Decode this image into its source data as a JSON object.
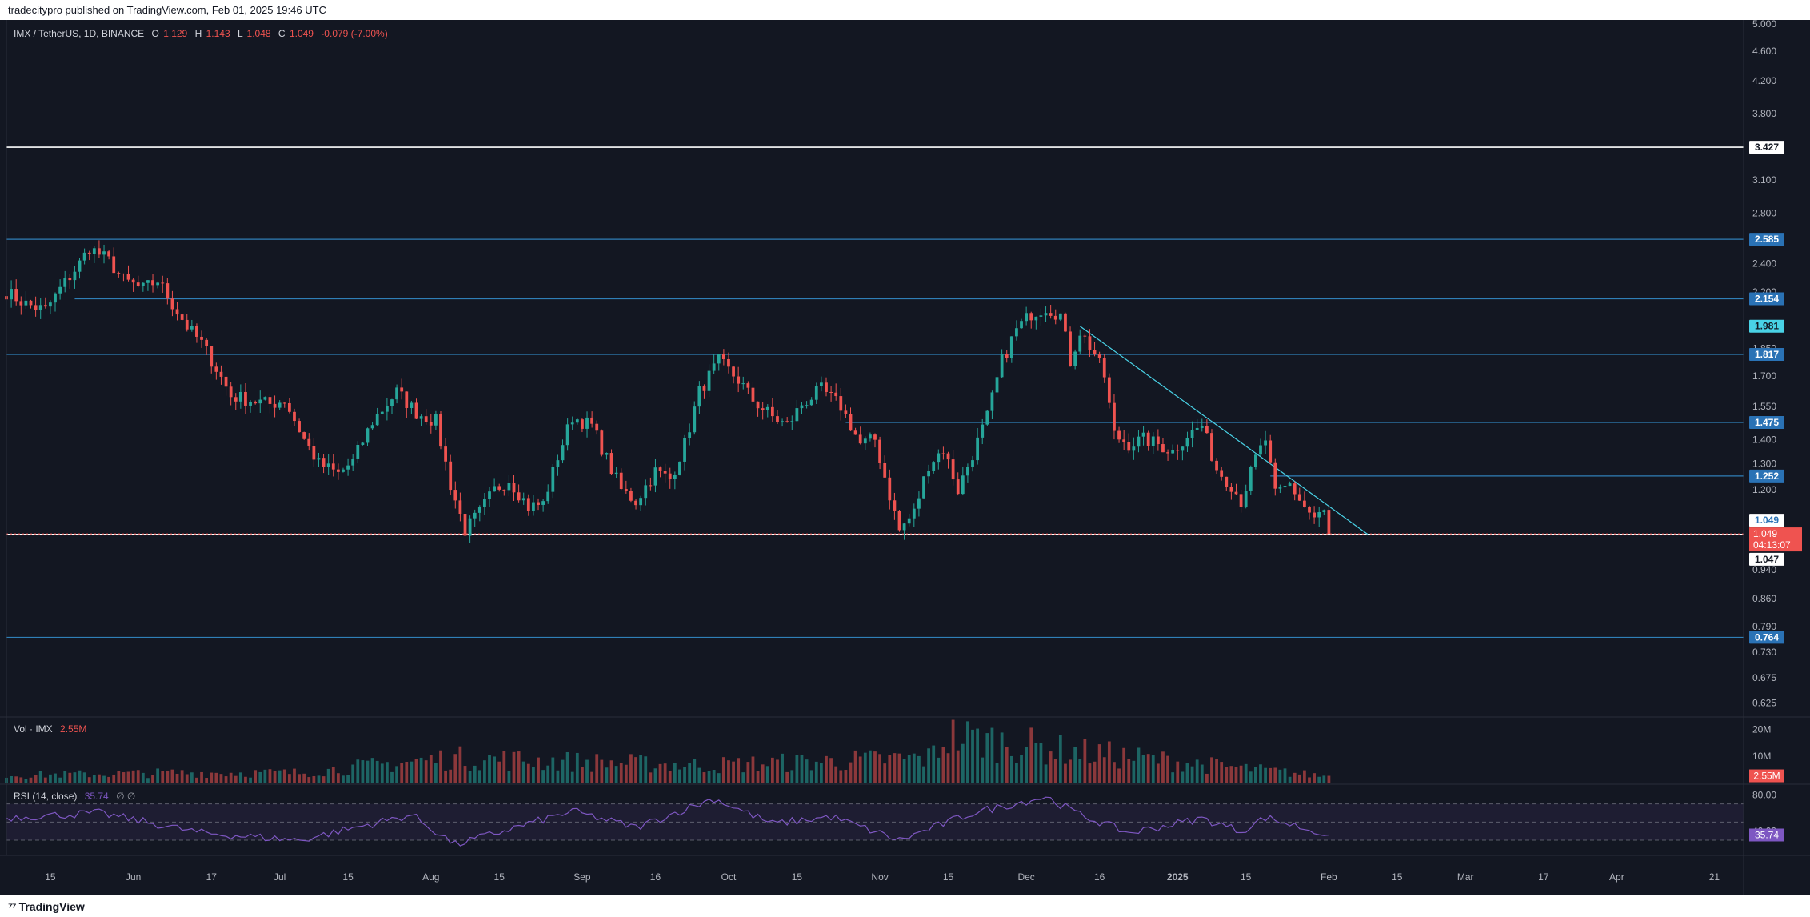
{
  "header": {
    "publisher_text": "tradecitypro published on TradingView.com, Feb 01, 2025 19:46 UTC"
  },
  "footer": {
    "brand_text": "TradingView"
  },
  "legend": {
    "symbol_text": "IMX / TetherUS, 1D, BINANCE",
    "open_label": "O",
    "open_value": "1.129",
    "high_label": "H",
    "high_value": "1.143",
    "low_label": "L",
    "low_value": "1.048",
    "close_label": "C",
    "close_value": "1.049",
    "change_text": "-0.079 (-7.00%)"
  },
  "volume_pane": {
    "label": "Vol · IMX",
    "value": "2.55M",
    "badge": "2.55M",
    "scale_labels": [
      "20M",
      "10M"
    ]
  },
  "rsi_pane": {
    "label": "RSI (14, close)",
    "value": "35.74",
    "extra": "∅  ∅",
    "badge": "35.74",
    "scale_labels": [
      "80.00",
      "40.00"
    ]
  },
  "price_axis": {
    "ticks": [
      "5.000",
      "4.600",
      "4.200",
      "3.800",
      "3.100",
      "2.800",
      "2.400",
      "2.200",
      "1.850",
      "1.700",
      "1.550",
      "1.400",
      "1.300",
      "1.200",
      "0.940",
      "0.860",
      "0.790",
      "0.730",
      "0.675",
      "0.625"
    ]
  },
  "time_axis": {
    "labels": [
      "15",
      "Jun",
      "17",
      "Jul",
      "15",
      "Aug",
      "15",
      "Sep",
      "16",
      "Oct",
      "15",
      "Nov",
      "15",
      "Dec",
      "16",
      "2025",
      "15",
      "Feb",
      "15",
      "Mar",
      "17",
      "Apr",
      "21"
    ]
  },
  "price_badges": {
    "current_price": "1.049",
    "countdown": "04:13:07",
    "bid_price": "1.049",
    "ask_price": "1.047",
    "trend_price": "1.981"
  },
  "colors": {
    "background": "#131722",
    "up": "#26a69a",
    "down": "#ef5350",
    "level_line": "#2f7fb7",
    "level_badge": "#2a72b5",
    "white_level": "#ffffff",
    "trendline": "#49d2e6",
    "rsi_line": "#7e57c2"
  },
  "icons": {
    "logo": "tradingview-logo-icon"
  },
  "chart_data": {
    "type": "candlestick",
    "symbol": "IMX / TetherUS",
    "interval": "1D",
    "exchange": "BINANCE",
    "price_scale": "log",
    "ylim": [
      0.6,
      5.0
    ],
    "x_range": [
      "2024-05-06",
      "2025-04-27"
    ],
    "last_candle": {
      "date": "2025-02-01",
      "open": 1.129,
      "high": 1.143,
      "low": 1.048,
      "close": 1.049,
      "change": -0.079,
      "change_pct": -7.0
    },
    "horizontal_levels": [
      {
        "price": 3.427,
        "color": "#ffffff",
        "start": "2024-05-06"
      },
      {
        "price": 2.585,
        "color": "#2f7fb7",
        "start": "2024-05-06"
      },
      {
        "price": 2.154,
        "color": "#2f7fb7",
        "start": "2024-05-20"
      },
      {
        "price": 1.817,
        "color": "#2f7fb7",
        "start": "2024-05-06"
      },
      {
        "price": 1.475,
        "color": "#2f7fb7",
        "start": "2024-10-25"
      },
      {
        "price": 1.252,
        "color": "#2f7fb7",
        "start": "2025-01-20"
      },
      {
        "price": 1.047,
        "color": "#ffffff",
        "start": "2024-05-06"
      },
      {
        "price": 0.764,
        "color": "#2f7fb7",
        "start": "2024-05-06"
      }
    ],
    "trendline": {
      "from": {
        "date": "2024-12-12",
        "price": 1.981
      },
      "to": {
        "date": "2025-02-09",
        "price": 1.047
      }
    },
    "close_path": [
      [
        "2024-05-06",
        2.2
      ],
      [
        "2024-05-10",
        2.12
      ],
      [
        "2024-05-14",
        2.08
      ],
      [
        "2024-05-17",
        2.22
      ],
      [
        "2024-05-21",
        2.4
      ],
      [
        "2024-05-23",
        2.52
      ],
      [
        "2024-05-27",
        2.42
      ],
      [
        "2024-05-30",
        2.28
      ],
      [
        "2024-06-03",
        2.22
      ],
      [
        "2024-06-06",
        2.28
      ],
      [
        "2024-06-09",
        2.12
      ],
      [
        "2024-06-12",
        1.98
      ],
      [
        "2024-06-15",
        1.88
      ],
      [
        "2024-06-18",
        1.74
      ],
      [
        "2024-06-21",
        1.6
      ],
      [
        "2024-06-25",
        1.58
      ],
      [
        "2024-06-29",
        1.56
      ],
      [
        "2024-07-02",
        1.58
      ],
      [
        "2024-07-06",
        1.4
      ],
      [
        "2024-07-09",
        1.3
      ],
      [
        "2024-07-13",
        1.26
      ],
      [
        "2024-07-16",
        1.31
      ],
      [
        "2024-07-20",
        1.48
      ],
      [
        "2024-07-25",
        1.62
      ],
      [
        "2024-07-29",
        1.52
      ],
      [
        "2024-08-02",
        1.48
      ],
      [
        "2024-08-05",
        1.22
      ],
      [
        "2024-08-08",
        1.06
      ],
      [
        "2024-08-11",
        1.12
      ],
      [
        "2024-08-14",
        1.2
      ],
      [
        "2024-08-17",
        1.24
      ],
      [
        "2024-08-21",
        1.14
      ],
      [
        "2024-08-24",
        1.15
      ],
      [
        "2024-08-27",
        1.33
      ],
      [
        "2024-08-30",
        1.5
      ],
      [
        "2024-09-03",
        1.46
      ],
      [
        "2024-09-06",
        1.32
      ],
      [
        "2024-09-09",
        1.2
      ],
      [
        "2024-09-12",
        1.16
      ],
      [
        "2024-09-16",
        1.27
      ],
      [
        "2024-09-19",
        1.24
      ],
      [
        "2024-09-22",
        1.38
      ],
      [
        "2024-09-25",
        1.62
      ],
      [
        "2024-09-29",
        1.78
      ],
      [
        "2024-10-03",
        1.68
      ],
      [
        "2024-10-06",
        1.58
      ],
      [
        "2024-10-10",
        1.5
      ],
      [
        "2024-10-13",
        1.46
      ],
      [
        "2024-10-16",
        1.56
      ],
      [
        "2024-10-20",
        1.63
      ],
      [
        "2024-10-24",
        1.55
      ],
      [
        "2024-10-28",
        1.38
      ],
      [
        "2024-10-31",
        1.4
      ],
      [
        "2024-11-03",
        1.18
      ],
      [
        "2024-11-05",
        1.06
      ],
      [
        "2024-11-08",
        1.12
      ],
      [
        "2024-11-11",
        1.3
      ],
      [
        "2024-11-14",
        1.36
      ],
      [
        "2024-11-17",
        1.2
      ],
      [
        "2024-11-20",
        1.34
      ],
      [
        "2024-11-23",
        1.5
      ],
      [
        "2024-11-26",
        1.78
      ],
      [
        "2024-11-29",
        1.96
      ],
      [
        "2024-12-02",
        2.06
      ],
      [
        "2024-12-05",
        2.1
      ],
      [
        "2024-12-08",
        2.05
      ],
      [
        "2024-12-10",
        1.78
      ],
      [
        "2024-12-12",
        1.95
      ],
      [
        "2024-12-15",
        1.82
      ],
      [
        "2024-12-17",
        1.7
      ],
      [
        "2024-12-19",
        1.42
      ],
      [
        "2024-12-22",
        1.38
      ],
      [
        "2024-12-25",
        1.4
      ],
      [
        "2024-12-28",
        1.38
      ],
      [
        "2024-12-31",
        1.35
      ],
      [
        "2025-01-03",
        1.42
      ],
      [
        "2025-01-06",
        1.46
      ],
      [
        "2025-01-09",
        1.28
      ],
      [
        "2025-01-12",
        1.22
      ],
      [
        "2025-01-14",
        1.16
      ],
      [
        "2025-01-17",
        1.32
      ],
      [
        "2025-01-19",
        1.4
      ],
      [
        "2025-01-21",
        1.18
      ],
      [
        "2025-01-24",
        1.22
      ],
      [
        "2025-01-27",
        1.14
      ],
      [
        "2025-01-29",
        1.1
      ],
      [
        "2025-01-31",
        1.12
      ],
      [
        "2025-02-01",
        1.049
      ]
    ],
    "volume_unit": "M",
    "volume_ylim": [
      0,
      22
    ],
    "volume_path": [
      [
        "2024-05-06",
        3
      ],
      [
        "2024-06-10",
        4
      ],
      [
        "2024-07-05",
        4
      ],
      [
        "2024-08-05",
        10
      ],
      [
        "2024-09-26",
        7
      ],
      [
        "2024-11-11",
        10
      ],
      [
        "2024-11-15",
        19
      ],
      [
        "2024-11-28",
        16
      ],
      [
        "2024-12-09",
        13
      ],
      [
        "2025-01-13",
        6
      ],
      [
        "2025-02-01",
        2.55
      ]
    ],
    "rsi_ylim": [
      15,
      90
    ],
    "rsi_bands": [
      30,
      70
    ],
    "rsi_path": [
      [
        "2024-05-06",
        55
      ],
      [
        "2024-05-25",
        60
      ],
      [
        "2024-06-15",
        38
      ],
      [
        "2024-07-05",
        30
      ],
      [
        "2024-07-28",
        58
      ],
      [
        "2024-08-06",
        25
      ],
      [
        "2024-08-30",
        62
      ],
      [
        "2024-09-12",
        44
      ],
      [
        "2024-09-28",
        76
      ],
      [
        "2024-10-10",
        48
      ],
      [
        "2024-10-22",
        56
      ],
      [
        "2024-11-05",
        30
      ],
      [
        "2024-11-20",
        60
      ],
      [
        "2024-12-05",
        78
      ],
      [
        "2024-12-12",
        58
      ],
      [
        "2024-12-22",
        38
      ],
      [
        "2025-01-06",
        54
      ],
      [
        "2025-01-14",
        40
      ],
      [
        "2025-01-19",
        55
      ],
      [
        "2025-02-01",
        35.74
      ]
    ]
  }
}
